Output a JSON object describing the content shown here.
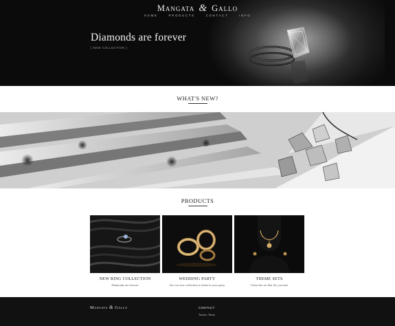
{
  "header": {
    "logo_left": "Mangata",
    "logo_amp": "&",
    "logo_right": "Gallo",
    "nav": [
      {
        "label": "HOME"
      },
      {
        "label": "PRODUCTS"
      },
      {
        "label": "CONTACT"
      },
      {
        "label": "INFO"
      }
    ]
  },
  "hero": {
    "title": "Diamonds are forever",
    "subtitle": "[ NEW COLLECTION ]"
  },
  "whats_new": {
    "heading": "WHAT'S NEW?"
  },
  "products": {
    "heading": "PRODUCTS",
    "items": [
      {
        "name": "NEW RING COLLECTION",
        "description": "Diamonds are forever"
      },
      {
        "name": "WEDDING PARTY",
        "description": "See our new collection to shine in your party"
      },
      {
        "name": "THEME SETS",
        "description": "Chose the set that fits you best"
      }
    ]
  },
  "footer": {
    "logo_left": "Mangata",
    "logo_amp": "&",
    "logo_right": "Gallo",
    "contact_title": "CONTACT",
    "contact_text": "Austin, Texas"
  },
  "colors": {
    "hero_background": "#0b0b0b",
    "footer_background": "#111111",
    "gold": "#c8a060"
  }
}
